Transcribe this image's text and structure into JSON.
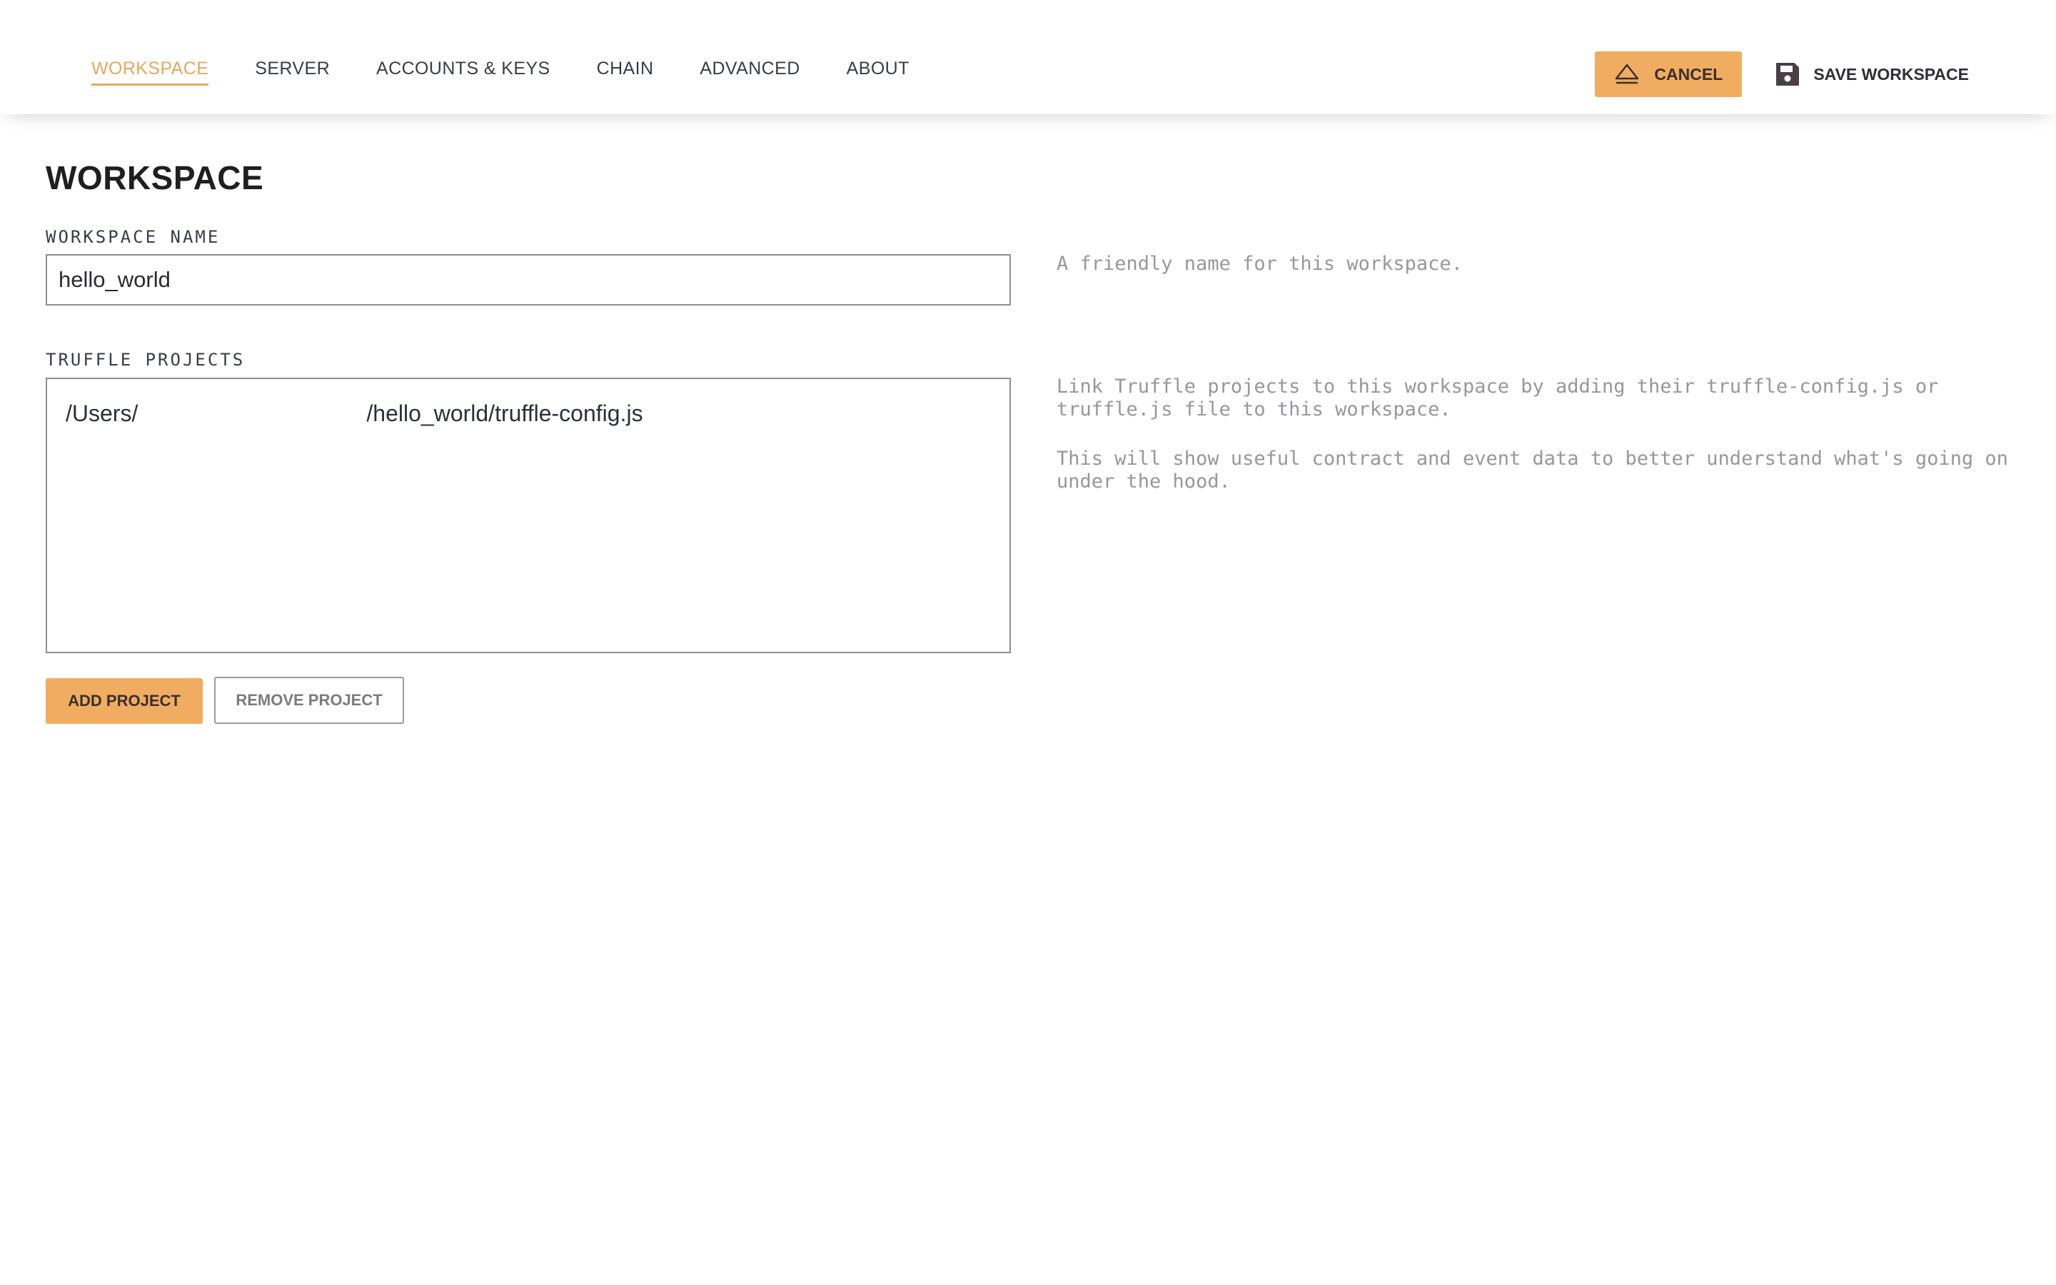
{
  "nav": {
    "tabs": [
      {
        "label": "WORKSPACE",
        "active": true
      },
      {
        "label": "SERVER",
        "active": false
      },
      {
        "label": "ACCOUNTS & KEYS",
        "active": false
      },
      {
        "label": "CHAIN",
        "active": false
      },
      {
        "label": "ADVANCED",
        "active": false
      },
      {
        "label": "ABOUT",
        "active": false
      }
    ]
  },
  "actions": {
    "cancel_label": "CANCEL",
    "cancel_icon": "eject-icon",
    "save_label": "SAVE WORKSPACE",
    "save_icon": "floppy-disk-icon"
  },
  "page": {
    "title": "WORKSPACE"
  },
  "workspace_name": {
    "label": "WORKSPACE NAME",
    "value": "hello_world",
    "help": "A friendly name for this workspace."
  },
  "truffle_projects": {
    "label": "TRUFFLE PROJECTS",
    "items": [
      "/Users/                                    /hello_world/truffle-config.js"
    ],
    "help_1": "Link Truffle projects to this workspace by adding their truffle-config.js or truffle.js file to this workspace.",
    "help_2": "This will show useful contract and event data to better understand what's going on under the hood."
  },
  "buttons": {
    "add_project": "ADD PROJECT",
    "remove_project": "REMOVE PROJECT"
  },
  "colors": {
    "accent": "#f0ad62",
    "active_tab": "#e6a85c",
    "help_text": "#97979c",
    "border": "#8e8e94"
  }
}
